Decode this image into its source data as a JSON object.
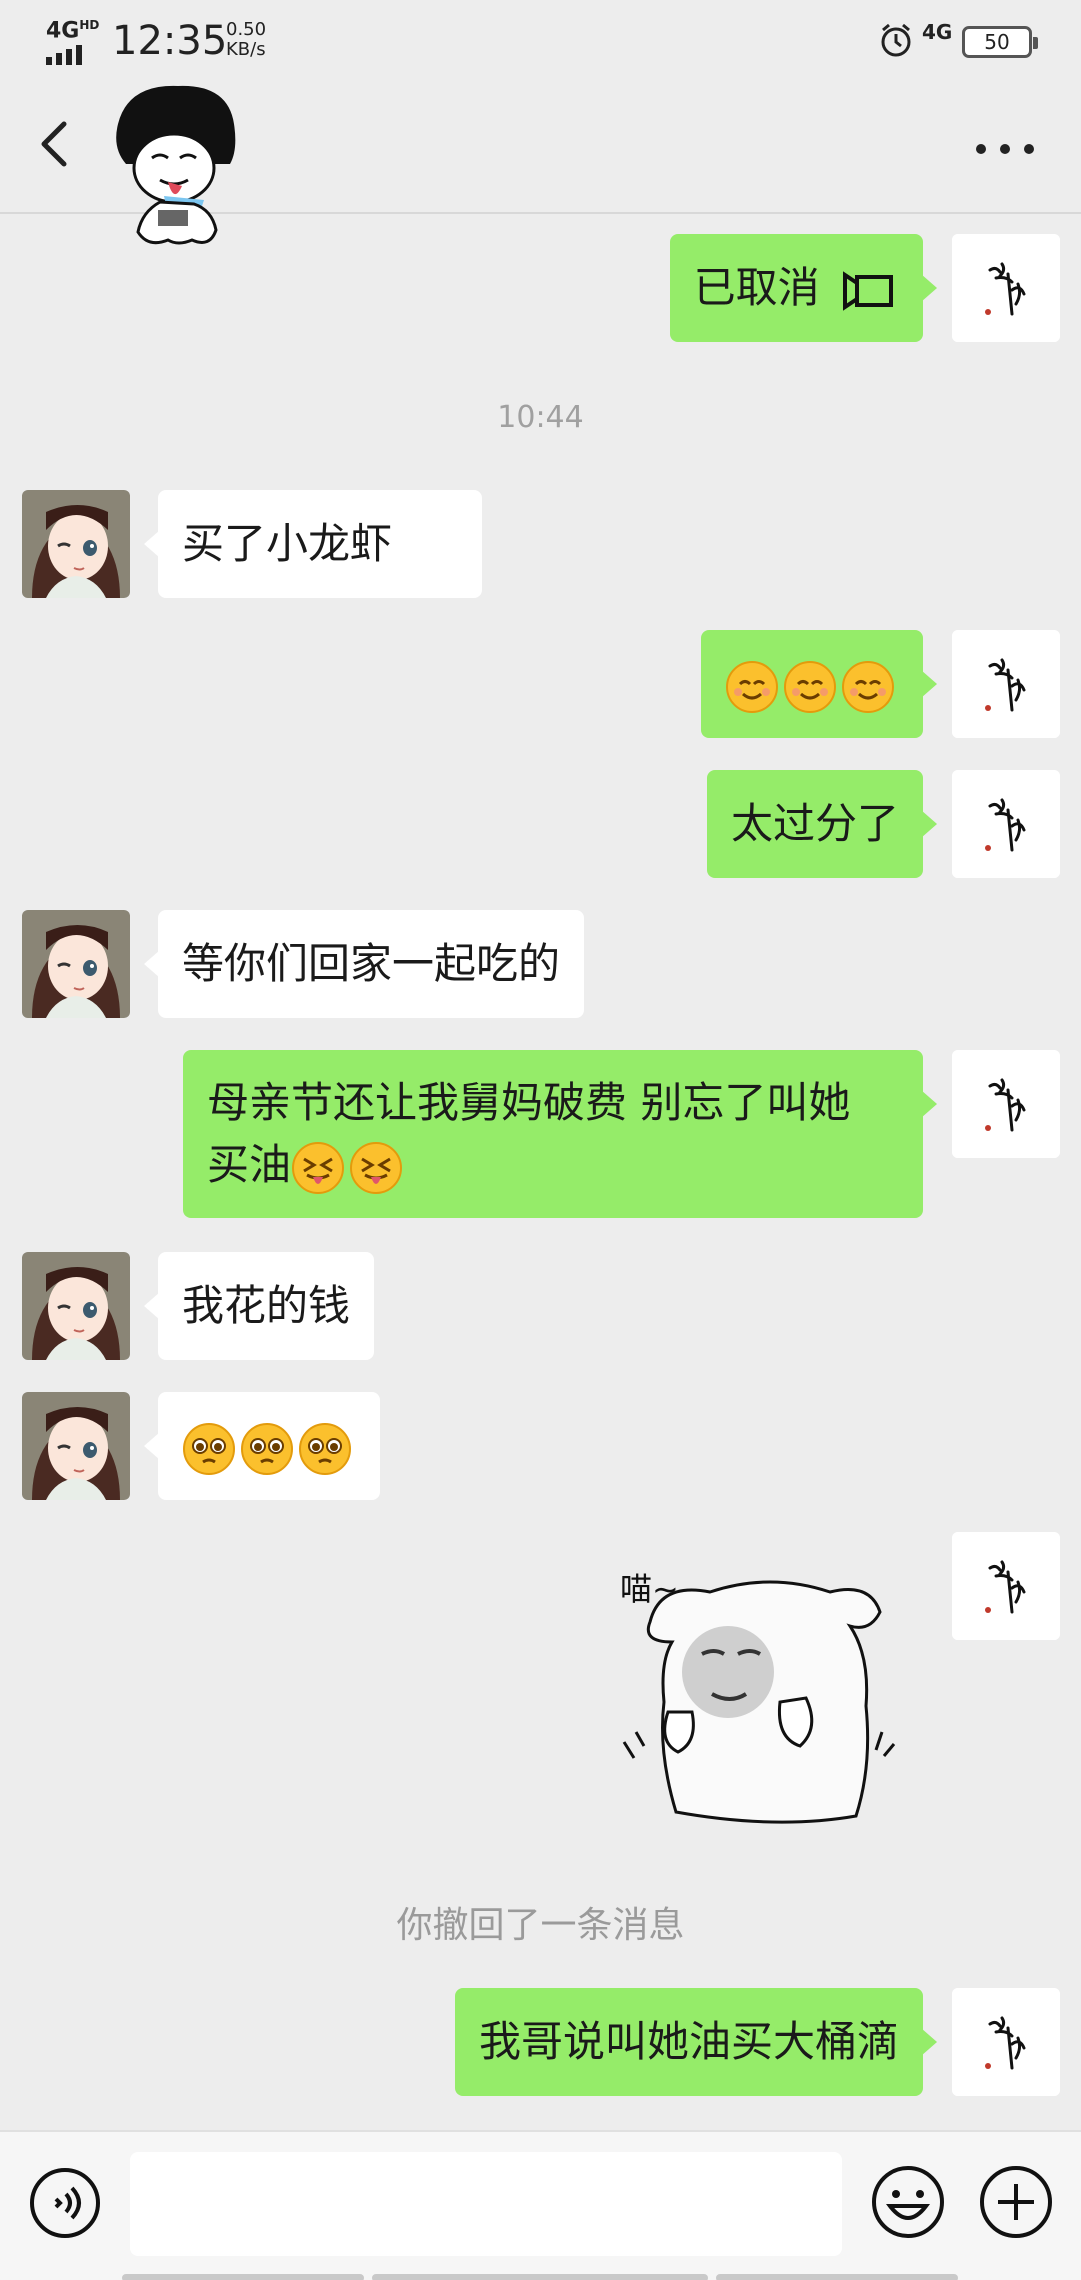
{
  "status_bar": {
    "network": "4G",
    "network_suffix": "HD",
    "time": "12:35",
    "speed_value": "0.50",
    "speed_unit": "KB/s",
    "network_right": "4G",
    "battery": "50"
  },
  "nav": {
    "back_icon": "chevron-left-icon",
    "more_icon": "more-horizontal-icon"
  },
  "messages": {
    "m1": {
      "text": "已取消",
      "icon": "video-call-icon"
    },
    "time1": "10:44",
    "m2": {
      "text": "买了小龙虾"
    },
    "m3": {
      "emoji": [
        "smiling-face-emoji",
        "smiling-face-emoji",
        "smiling-face-emoji"
      ]
    },
    "m4": {
      "text": "太过分了"
    },
    "m5": {
      "text": "等你们回家一起吃的"
    },
    "m6": {
      "text_line1": "母亲节还让我舅妈破费 别忘了叫她",
      "text_line2": "买油",
      "emoji": [
        "squinting-tongue-emoji",
        "squinting-tongue-emoji"
      ]
    },
    "m7": {
      "text": "我花的钱"
    },
    "m8": {
      "emoji": [
        "pleading-face-emoji",
        "pleading-face-emoji",
        "pleading-face-emoji"
      ]
    },
    "m9": {
      "sticker_caption": "喵~",
      "sticker": "meme-cat-sticker"
    },
    "system_note": "你撤回了一条消息",
    "m10": {
      "text": "我哥说叫她油买大桶滴"
    }
  },
  "input_bar": {
    "placeholder": "",
    "voice_icon": "voice-icon",
    "emoji_icon": "emoji-icon",
    "plus_icon": "plus-icon"
  },
  "colors": {
    "self_bubble": "#95ec69",
    "other_bubble": "#ffffff",
    "background": "#ededed"
  }
}
